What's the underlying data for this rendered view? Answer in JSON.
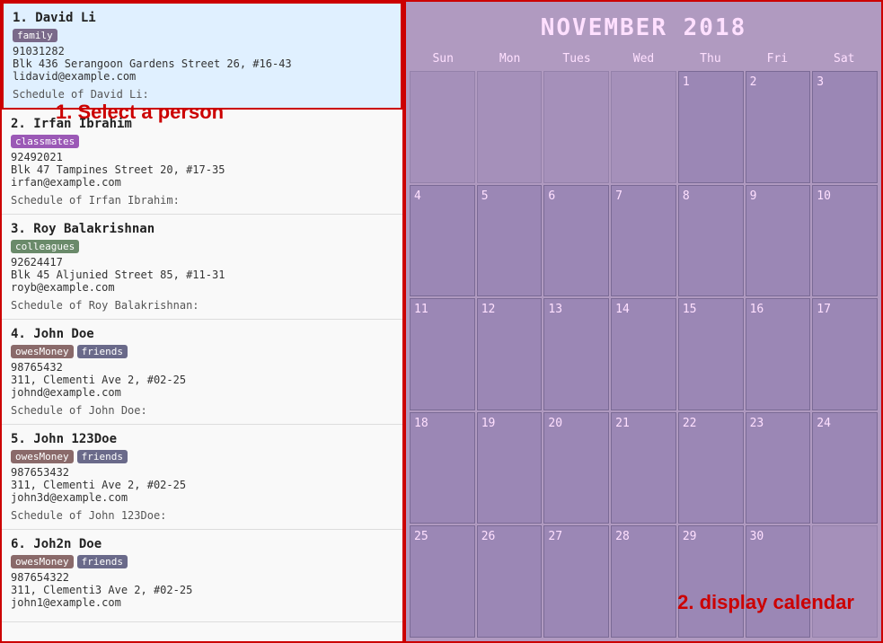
{
  "left_panel": {
    "contacts": [
      {
        "index": 1,
        "name": "David Li",
        "tags": [
          {
            "label": "family",
            "class": "tag-family"
          }
        ],
        "phone": "91031282",
        "address": "Blk 436 Serangoon Gardens Street 26, #16-43",
        "email": "lidavid@example.com",
        "schedule_label": "Schedule of David Li:",
        "selected": true
      },
      {
        "index": 2,
        "name": "Irfan Ibrahim",
        "tags": [
          {
            "label": "classmates",
            "class": "tag-classmates"
          }
        ],
        "phone": "92492021",
        "address": "Blk 47 Tampines Street 20, #17-35",
        "email": "irfan@example.com",
        "schedule_label": "Schedule of Irfan Ibrahim:",
        "selected": false
      },
      {
        "index": 3,
        "name": "Roy Balakrishnan",
        "tags": [
          {
            "label": "colleagues",
            "class": "tag-colleagues"
          }
        ],
        "phone": "92624417",
        "address": "Blk 45 Aljunied Street 85, #11-31",
        "email": "royb@example.com",
        "schedule_label": "Schedule of Roy Balakrishnan:",
        "selected": false
      },
      {
        "index": 4,
        "name": "John Doe",
        "tags": [
          {
            "label": "owesMoney",
            "class": "tag-owesMoney"
          },
          {
            "label": "friends",
            "class": "tag-friends"
          }
        ],
        "phone": "98765432",
        "address": "311, Clementi Ave 2, #02-25",
        "email": "johnd@example.com",
        "schedule_label": "Schedule of John Doe:",
        "selected": false
      },
      {
        "index": 5,
        "name": "John 123Doe",
        "tags": [
          {
            "label": "owesMoney",
            "class": "tag-owesMoney"
          },
          {
            "label": "friends",
            "class": "tag-friends"
          }
        ],
        "phone": "987653432",
        "address": "311, Clementi Ave 2, #02-25",
        "email": "john3d@example.com",
        "schedule_label": "Schedule of John 123Doe:",
        "selected": false
      },
      {
        "index": 6,
        "name": "Joh2n Doe",
        "tags": [
          {
            "label": "owesMoney",
            "class": "tag-owesMoney"
          },
          {
            "label": "friends",
            "class": "tag-friends"
          }
        ],
        "phone": "987654322",
        "address": "311, Clementi3 Ave 2, #02-25",
        "email": "john1@example.com",
        "schedule_label": "",
        "selected": false
      }
    ]
  },
  "calendar": {
    "title": "NOVEMBER 2018",
    "weekdays": [
      "Sun",
      "Mon",
      "Tues",
      "Wed",
      "Thu",
      "Fri",
      "Sat"
    ],
    "weeks": [
      [
        null,
        null,
        null,
        null,
        1,
        2,
        3
      ],
      [
        4,
        5,
        6,
        7,
        8,
        9,
        10
      ],
      [
        11,
        12,
        13,
        14,
        15,
        16,
        17
      ],
      [
        18,
        19,
        20,
        21,
        22,
        23,
        24
      ],
      [
        25,
        26,
        27,
        28,
        29,
        30,
        null
      ]
    ]
  },
  "hints": {
    "select_person": "1. Select a person",
    "display_calendar": "2. display calendar"
  }
}
